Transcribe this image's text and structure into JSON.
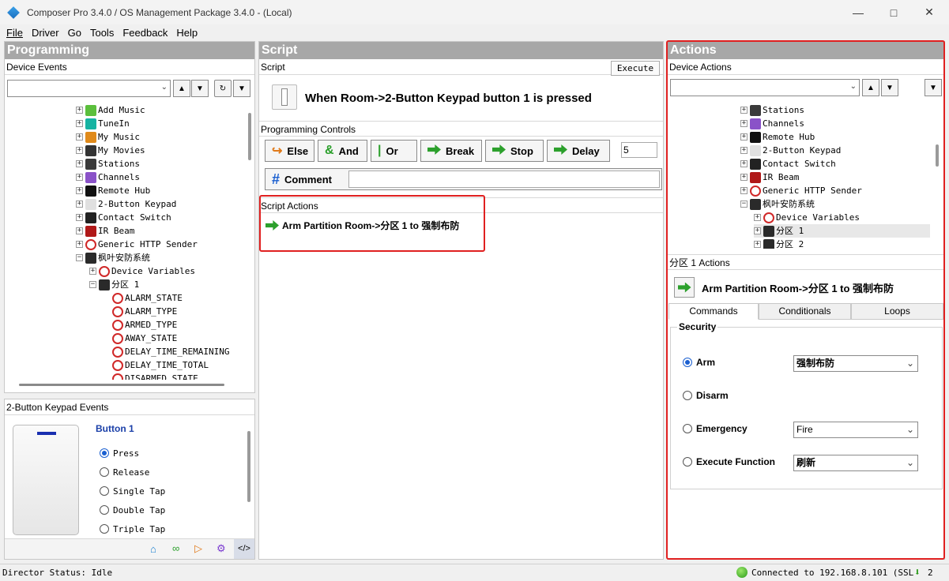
{
  "window": {
    "title": "Composer Pro 3.4.0 / OS Management Package 3.4.0 - (Local)"
  },
  "menu": [
    "File",
    "Driver",
    "Go",
    "Tools",
    "Feedback",
    "Help"
  ],
  "programming": {
    "header": "Programming",
    "device_events_label": "Device Events",
    "tree": [
      {
        "label": "Add Music",
        "icon": "music-add-icon",
        "color": "#5bbf3c",
        "level": 0
      },
      {
        "label": "TuneIn",
        "icon": "tunein-icon",
        "color": "#16b3a2",
        "level": 0
      },
      {
        "label": "My Music",
        "icon": "my-music-icon",
        "color": "#e08a1a",
        "level": 0
      },
      {
        "label": "My Movies",
        "icon": "my-movies-icon",
        "color": "#333333",
        "level": 0
      },
      {
        "label": "Stations",
        "icon": "stations-icon",
        "color": "#3a3a3a",
        "level": 0
      },
      {
        "label": "Channels",
        "icon": "channels-icon",
        "color": "#8a52c8",
        "level": 0
      },
      {
        "label": "Remote Hub",
        "icon": "remote-hub-icon",
        "color": "#111111",
        "level": 0
      },
      {
        "label": "2-Button Keypad",
        "icon": "keypad-icon",
        "color": "#e0e0e0",
        "level": 0
      },
      {
        "label": "Contact Switch",
        "icon": "contact-switch-icon",
        "color": "#222222",
        "level": 0
      },
      {
        "label": "IR Beam",
        "icon": "ir-beam-icon",
        "color": "#b01818",
        "level": 0
      },
      {
        "label": "Generic HTTP Sender",
        "icon": "c4-icon",
        "color": "#d02828",
        "level": 0
      },
      {
        "label": "枫叶安防系统",
        "icon": "security-panel-icon",
        "color": "#2a2a2a",
        "level": 0,
        "expanded": true
      },
      {
        "label": "Device Variables",
        "icon": "c4-icon",
        "color": "#d02828",
        "level": 1
      },
      {
        "label": "分区 1",
        "icon": "partition-icon",
        "color": "#2a2a2a",
        "level": 1,
        "expanded": true
      },
      {
        "label": "ALARM_STATE",
        "icon": "c4-icon",
        "color": "#d02828",
        "level": 2
      },
      {
        "label": "ALARM_TYPE",
        "icon": "c4-icon",
        "color": "#d02828",
        "level": 2
      },
      {
        "label": "ARMED_TYPE",
        "icon": "c4-icon",
        "color": "#d02828",
        "level": 2
      },
      {
        "label": "AWAY_STATE",
        "icon": "c4-icon",
        "color": "#d02828",
        "level": 2
      },
      {
        "label": "DELAY_TIME_REMAINING",
        "icon": "c4-icon",
        "color": "#d02828",
        "level": 2
      },
      {
        "label": "DELAY_TIME_TOTAL",
        "icon": "c4-icon",
        "color": "#d02828",
        "level": 2
      },
      {
        "label": "DISARMED_STATE",
        "icon": "c4-icon",
        "color": "#d02828",
        "level": 2
      }
    ],
    "keypad_events_label": "2-Button Keypad Events",
    "button_title": "Button 1",
    "events": [
      {
        "label": "Press",
        "selected": true
      },
      {
        "label": "Release",
        "selected": false
      },
      {
        "label": "Single Tap",
        "selected": false
      },
      {
        "label": "Double Tap",
        "selected": false
      },
      {
        "label": "Triple Tap",
        "selected": false
      }
    ]
  },
  "script": {
    "header": "Script",
    "script_label": "Script",
    "execute_label": "Execute",
    "when_text": "When Room->2-Button Keypad button 1 is pressed",
    "controls_label": "Programming Controls",
    "controls": [
      {
        "label": "Else",
        "icon": "else-icon"
      },
      {
        "label": "And",
        "icon": "and-icon"
      },
      {
        "label": "Or",
        "icon": "or-icon"
      },
      {
        "label": "Break",
        "icon": "break-icon"
      },
      {
        "label": "Stop",
        "icon": "stop-icon"
      },
      {
        "label": "Delay",
        "icon": "delay-icon"
      }
    ],
    "delay_value": "5",
    "comment_label": "Comment",
    "actions_label": "Script Actions",
    "action_item": "Arm Partition  Room->分区 1 to 强制布防"
  },
  "actions": {
    "header": "Actions",
    "device_actions_label": "Device Actions",
    "tree": [
      {
        "label": "Stations",
        "icon": "stations-icon",
        "color": "#3a3a3a",
        "level": 0
      },
      {
        "label": "Channels",
        "icon": "channels-icon",
        "color": "#8a52c8",
        "level": 0
      },
      {
        "label": "Remote Hub",
        "icon": "remote-hub-icon",
        "color": "#111111",
        "level": 0
      },
      {
        "label": "2-Button Keypad",
        "icon": "keypad-icon",
        "color": "#e0e0e0",
        "level": 0
      },
      {
        "label": "Contact Switch",
        "icon": "contact-switch-icon",
        "color": "#222222",
        "level": 0
      },
      {
        "label": "IR Beam",
        "icon": "ir-beam-icon",
        "color": "#b01818",
        "level": 0
      },
      {
        "label": "Generic HTTP Sender",
        "icon": "c4-icon",
        "color": "#d02828",
        "level": 0
      },
      {
        "label": "枫叶安防系统",
        "icon": "security-panel-icon",
        "color": "#2a2a2a",
        "level": 0,
        "expanded": true
      },
      {
        "label": "Device Variables",
        "icon": "c4-icon",
        "color": "#d02828",
        "level": 1
      },
      {
        "label": "分区 1",
        "icon": "partition-icon",
        "color": "#2a2a2a",
        "level": 1,
        "selected": true
      },
      {
        "label": "分区 2",
        "icon": "partition-icon",
        "color": "#2a2a2a",
        "level": 1
      }
    ],
    "partition_actions_label": "分区 1 Actions",
    "action_preview": "Arm Partition  Room->分区 1 to 强制布防",
    "tabs": [
      "Commands",
      "Conditionals",
      "Loops"
    ],
    "group_label": "Security",
    "options": [
      {
        "label": "Arm",
        "selected": true,
        "value": "强制布防"
      },
      {
        "label": "Disarm",
        "selected": false,
        "value": ""
      },
      {
        "label": "Emergency",
        "selected": false,
        "value": "Fire"
      },
      {
        "label": "Execute Function",
        "selected": false,
        "value": "刷新"
      }
    ]
  },
  "status": {
    "director": "Director Status: Idle",
    "connection": "Connected to 192.168.8.101 (SSL",
    "count": "2"
  },
  "colors": {
    "highlight_red": "#e02020",
    "header_gray": "#a7a7a7",
    "link_blue": "#1a3fa8"
  }
}
